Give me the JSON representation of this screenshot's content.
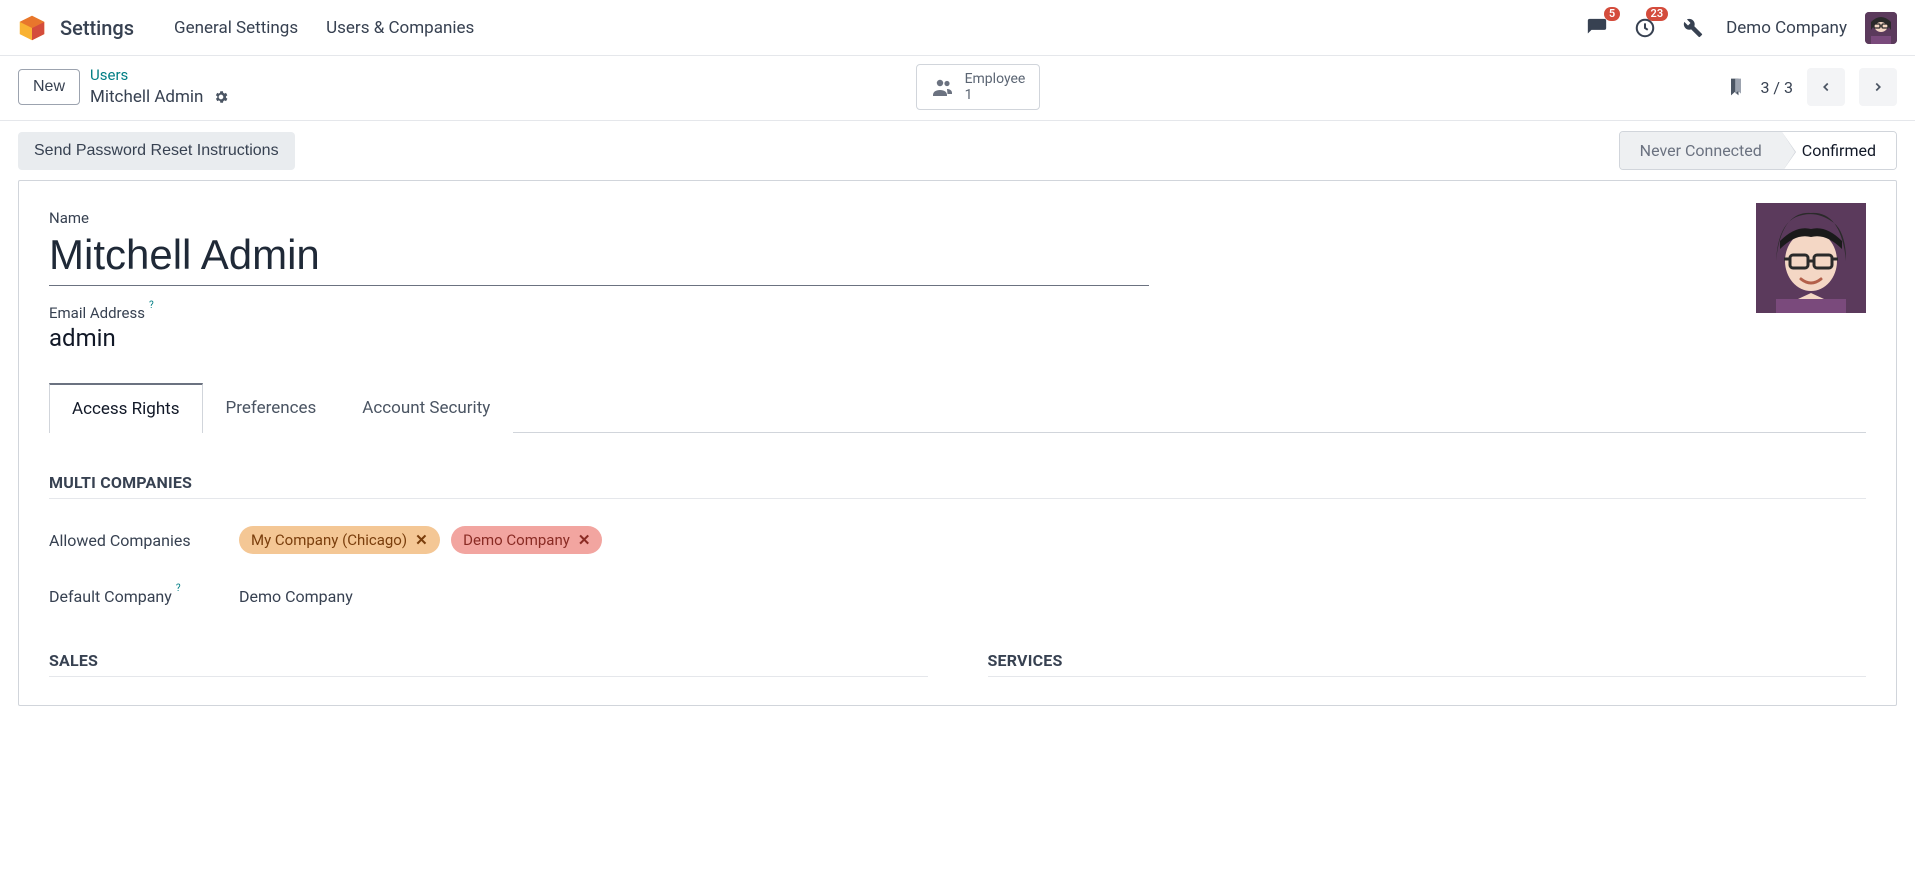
{
  "nav": {
    "appTitle": "Settings",
    "items": [
      "General Settings",
      "Users & Companies"
    ],
    "messagesBadge": "5",
    "activitiesBadge": "23",
    "companyName": "Demo Company"
  },
  "cp": {
    "newLabel": "New",
    "breadcrumbParent": "Users",
    "breadcrumbCurrent": "Mitchell Admin",
    "statLabel": "Employee",
    "statCount": "1",
    "pager": "3 / 3"
  },
  "actions": {
    "sendReset": "Send Password Reset Instructions",
    "status": [
      "Never Connected",
      "Confirmed"
    ],
    "activeStatusIndex": 1
  },
  "form": {
    "nameLabel": "Name",
    "nameValue": "Mitchell Admin",
    "emailLabel": "Email Address",
    "emailValue": "admin",
    "tabs": [
      "Access Rights",
      "Preferences",
      "Account Security"
    ],
    "activeTabIndex": 0
  },
  "multiCompanies": {
    "title": "MULTI COMPANIES",
    "allowedLabel": "Allowed Companies",
    "allowed": [
      "My Company (Chicago)",
      "Demo Company"
    ],
    "defaultLabel": "Default Company",
    "defaultValue": "Demo Company"
  },
  "sections": {
    "sales": "SALES",
    "services": "SERVICES"
  }
}
